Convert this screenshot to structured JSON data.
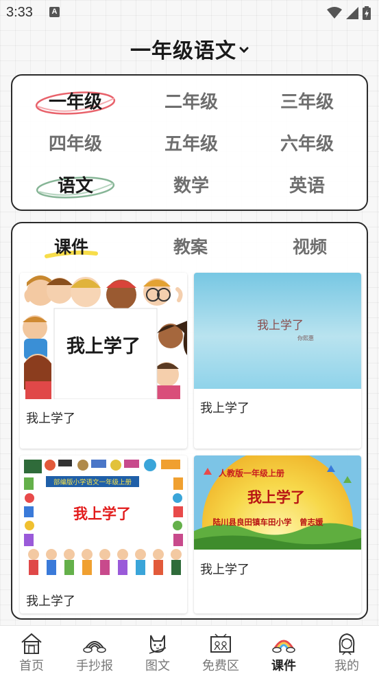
{
  "status_bar": {
    "time": "3:33",
    "notification_letter": "A"
  },
  "header": {
    "title": "一年级语文"
  },
  "grades": [
    "一年级",
    "二年级",
    "三年级",
    "四年级",
    "五年级",
    "六年级"
  ],
  "selected_grade": "一年级",
  "subjects": [
    "语文",
    "数学",
    "英语"
  ],
  "selected_subject": "语文",
  "tabs": [
    "课件",
    "教案",
    "视频"
  ],
  "selected_tab": "课件",
  "cards": [
    {
      "caption": "我上学了",
      "thumb_text": "我上学了"
    },
    {
      "caption": "我上学了",
      "thumb_text": "我上学了",
      "thumb_small": "你熙惠"
    },
    {
      "caption": "我上学了",
      "thumb_text": "我上学了",
      "thumb_banner": "部编版小学语文一年级上册"
    },
    {
      "caption": "我上学了",
      "thumb_text": "我上学了",
      "thumb_top": "人教版一年级上册",
      "thumb_bottom": "陆川县良田镇车田小学　曾志媛"
    }
  ],
  "nav": [
    {
      "label": "首页",
      "icon": "house-icon"
    },
    {
      "label": "手抄报",
      "icon": "rainbow-icon"
    },
    {
      "label": "图文",
      "icon": "cat-icon"
    },
    {
      "label": "免费区",
      "icon": "chalkboard-icon"
    },
    {
      "label": "课件",
      "icon": "colored-rainbow-icon"
    },
    {
      "label": "我的",
      "icon": "girl-icon"
    }
  ],
  "active_nav": "课件",
  "colors": {
    "accent_green": "#7fb08e",
    "accent_red": "#e23b3b",
    "accent_yellow": "#f7dd4a",
    "sky_blue": "#8fd3ea"
  }
}
